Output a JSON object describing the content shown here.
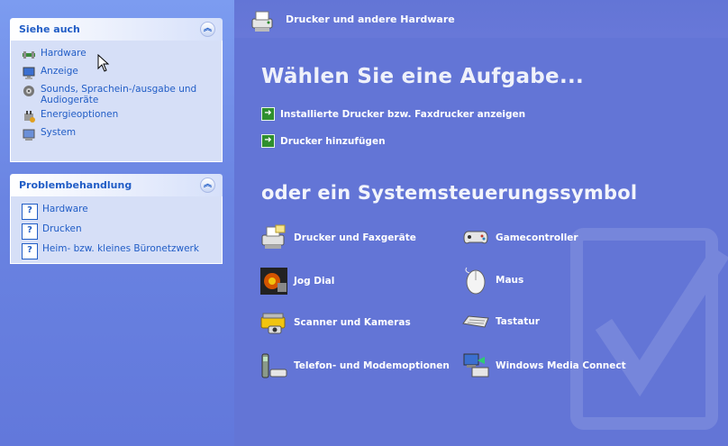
{
  "see_also": {
    "title": "Siehe auch",
    "items": [
      {
        "label": "Hardware",
        "icon": "hardware-icon"
      },
      {
        "label": "Anzeige",
        "icon": "display-icon"
      },
      {
        "label": "Sounds, Sprachein-/ausgabe und Audiogeräte",
        "icon": "sounds-icon"
      },
      {
        "label": "Energieoptionen",
        "icon": "power-options-icon"
      },
      {
        "label": "System",
        "icon": "system-icon"
      }
    ]
  },
  "troubleshooting": {
    "title": "Problembehandlung",
    "items": [
      {
        "label": "Hardware",
        "icon": "help-icon"
      },
      {
        "label": "Drucken",
        "icon": "help-icon"
      },
      {
        "label": "Heim- bzw. kleines Büronetzwerk",
        "icon": "help-icon"
      }
    ]
  },
  "header": {
    "title": "Drucker und andere Hardware"
  },
  "main": {
    "task_heading": "Wählen Sie eine Aufgabe...",
    "tasks": [
      {
        "label": "Installierte Drucker bzw. Faxdrucker anzeigen"
      },
      {
        "label": "Drucker hinzufügen"
      }
    ],
    "symbol_heading": "oder ein Systemsteuerungssymbol",
    "symbols": [
      {
        "label": "Drucker und Faxgeräte",
        "icon": "printer-fax-icon"
      },
      {
        "label": "Gamecontroller",
        "icon": "gamecontroller-icon"
      },
      {
        "label": "Jog Dial",
        "icon": "jog-dial-icon"
      },
      {
        "label": "Maus",
        "icon": "mouse-icon"
      },
      {
        "label": "Scanner und Kameras",
        "icon": "scanner-camera-icon"
      },
      {
        "label": "Tastatur",
        "icon": "keyboard-icon"
      },
      {
        "label": "Telefon- und Modemoptionen",
        "icon": "phone-modem-icon"
      },
      {
        "label": "Windows Media Connect",
        "icon": "media-connect-icon"
      }
    ]
  },
  "colors": {
    "background": "#6375d6",
    "link": "#215dc6",
    "panel_body": "#d6dff7"
  }
}
